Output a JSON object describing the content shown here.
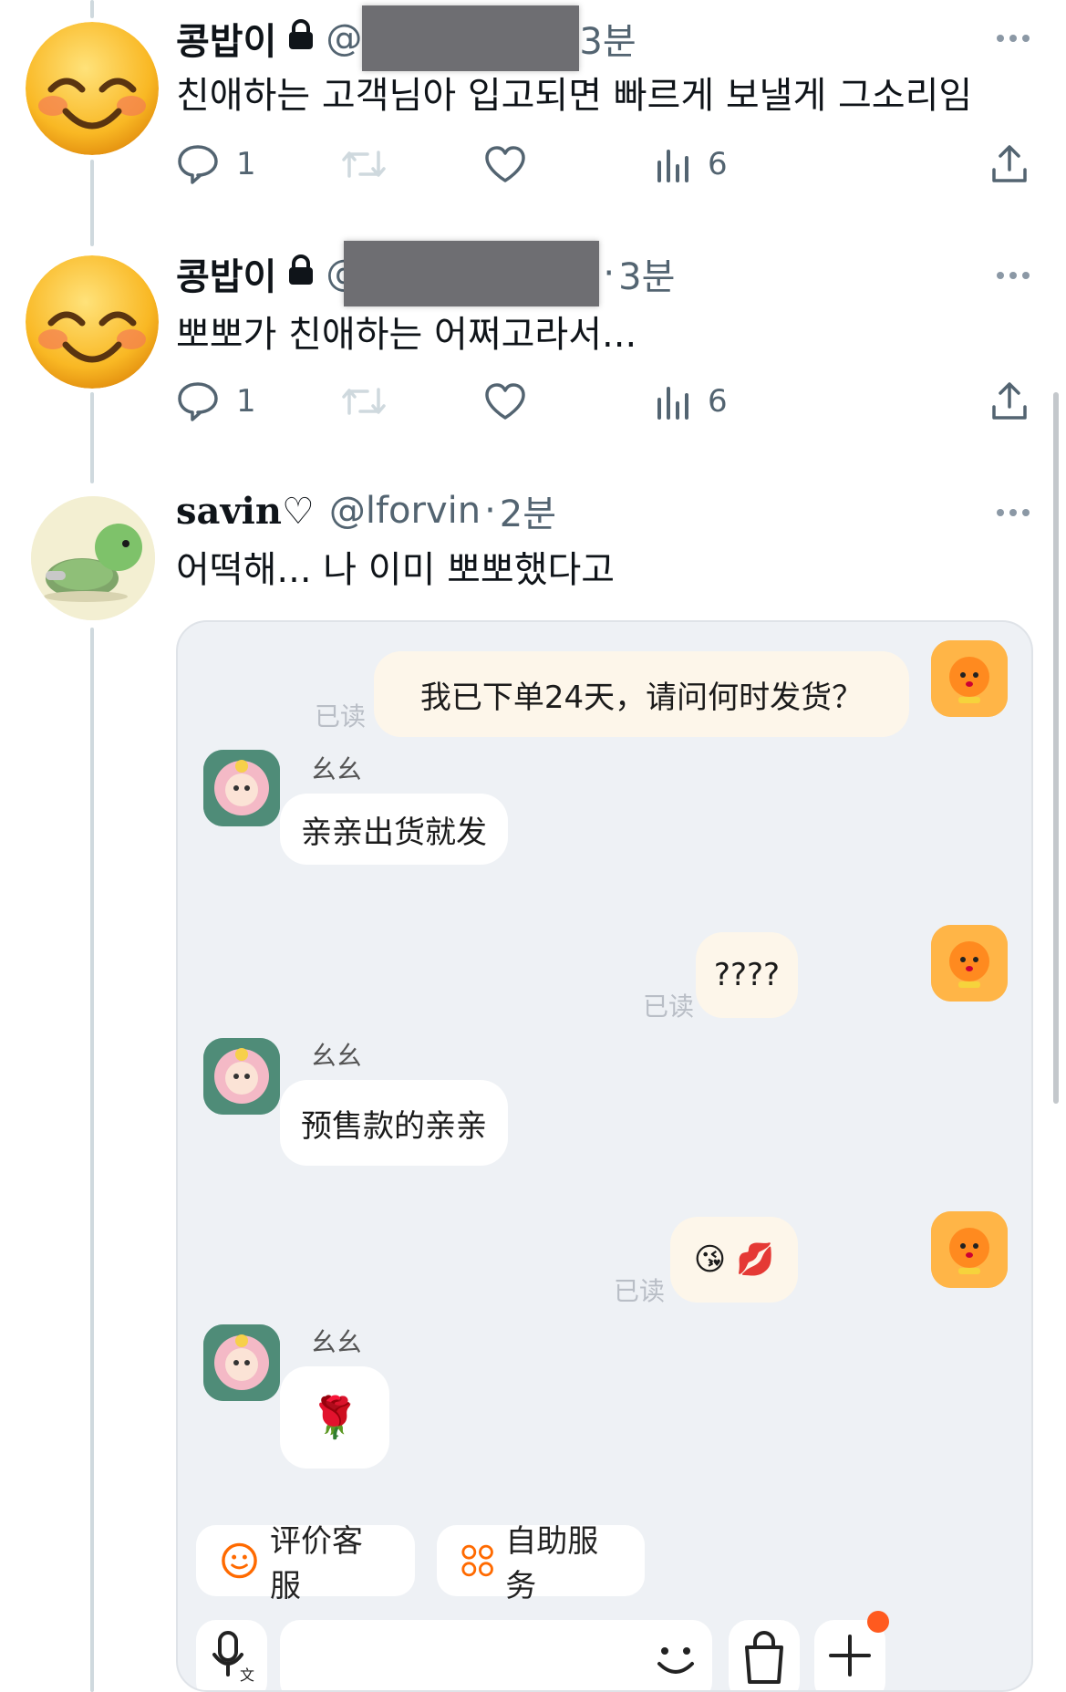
{
  "tweets": [
    {
      "name": "콩밥이",
      "handle": "@",
      "time": "3분",
      "text": "친애하는 고객님아 입고되면 빠르게 보낼게 그소리임",
      "replies": "1",
      "views": "6"
    },
    {
      "name": "콩밥이",
      "handle": "@",
      "time": "3분",
      "dot": "·",
      "text": "뽀뽀가 친애하는 어쩌고라서...",
      "replies": "1",
      "views": "6"
    },
    {
      "name": "savin♡",
      "handle": "@lforvin",
      "dot": "·",
      "time": "2분",
      "text": "어떡해... 나 이미 뽀뽀했다고"
    }
  ],
  "chat": {
    "messages": [
      {
        "side": "right",
        "text": "我已下单24天，请问何时发货？",
        "read": "已读"
      },
      {
        "side": "left",
        "nick": "幺幺",
        "text": "亲亲出货就发"
      },
      {
        "side": "right",
        "text": "????",
        "read": "已读"
      },
      {
        "side": "left",
        "nick": "幺幺",
        "text": "预售款的亲亲"
      },
      {
        "side": "right",
        "text": "😘 💋",
        "read": "已读"
      },
      {
        "side": "left",
        "nick": "幺幺",
        "text": "🌹"
      }
    ],
    "quick_actions": [
      {
        "label": "评价客服",
        "icon": "smile-icon"
      },
      {
        "label": "自助服务",
        "icon": "grid-icon"
      }
    ],
    "colors": {
      "accent": "#ff6a00",
      "bubble_right": "#fdf6ea",
      "bubble_left": "#ffffff",
      "chat_bg": "#eef1f5"
    }
  },
  "colors": {
    "text": "#0f1419",
    "muted": "#536471",
    "thread_line": "#cfd9de"
  }
}
